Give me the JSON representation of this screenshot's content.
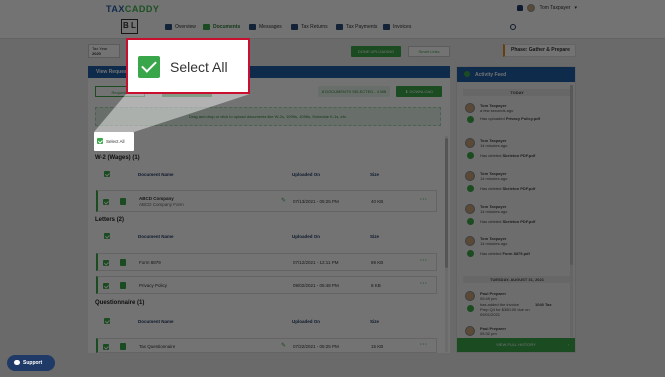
{
  "header": {
    "logo_main": "TAX",
    "logo_accent": "CADDY",
    "user_name": "Tom Taxpayer",
    "user_caret": "▾"
  },
  "nav": {
    "brand": "B L",
    "items": [
      {
        "label": "Overview",
        "icon": "home-icon"
      },
      {
        "label": "Documents",
        "icon": "documents-icon",
        "active": true
      },
      {
        "label": "Messages",
        "icon": "messages-icon"
      },
      {
        "label": "Tax Returns",
        "icon": "tax-returns-icon"
      },
      {
        "label": "Tax Payments",
        "icon": "dollar-icon"
      },
      {
        "label": "Invoices",
        "icon": "invoice-icon"
      }
    ]
  },
  "subbar": {
    "tax_year_label": "Tax Year",
    "tax_year_value": "2020",
    "done_uploading": "DONE UPLOADING",
    "smart_links": "Smart Links",
    "phase": "Phase: Gather & Prepare"
  },
  "main": {
    "title": "View Requests",
    "tab_requests": "Requests",
    "selected_info": "8 DOCUMENTS SELECTED - 4 MB",
    "download": "DOWNLOAD",
    "upload_hint": "Drag and drop or click to upload documents like W-2s, 1099s, 1098s, Schedule K-1s, etc.",
    "select_all": "Select All",
    "columns": {
      "name": "Document Name",
      "uploaded": "Uploaded On",
      "size": "Size"
    },
    "sections": [
      {
        "title": "W-2 (Wages)",
        "count": "(1)",
        "rows": [
          {
            "name": "ABCD Company",
            "sub": "ABCD Company Form",
            "date": "07/13/2021 - 05:25 PM",
            "size": "40 KB",
            "edit": true
          }
        ]
      },
      {
        "title": "Letters",
        "count": "(2)",
        "rows": [
          {
            "name": "Form 8879",
            "sub": "",
            "date": "07/12/2021 - 12:11 PM",
            "size": "89 KB",
            "edit": false
          },
          {
            "name": "Privacy Policy",
            "sub": "",
            "date": "09/02/2021 - 05:48 PM",
            "size": "8 KB",
            "edit": false
          }
        ]
      },
      {
        "title": "Questionnaire",
        "count": "(1)",
        "rows": [
          {
            "name": "Tax Questionnaire",
            "sub": "",
            "date": "07/22/2021 - 05:25 PM",
            "size": "15 KB",
            "edit": true
          }
        ]
      }
    ]
  },
  "callout": {
    "label": "Select All"
  },
  "feed": {
    "title": "Activity Feed",
    "today": "TODAY",
    "items": [
      {
        "who": "Tom Taxpayer",
        "when": "a few seconds ago",
        "what": "Has uploaded",
        "obj": "Privacy Policy.pdf"
      },
      {
        "who": "Tom Taxpayer",
        "when": "14 minutes ago",
        "what": "Has deleted",
        "obj": "Skeleton PDF.pdf"
      },
      {
        "who": "Tom Taxpayer",
        "when": "14 minutes ago",
        "what": "Has deleted",
        "obj": "Skeleton PDF.pdf"
      },
      {
        "who": "Tom Taxpayer",
        "when": "14 minutes ago",
        "what": "Has deleted",
        "obj": "Skeleton PDF.pdf"
      },
      {
        "who": "Tom Taxpayer",
        "when": "14 minutes ago",
        "what": "Has deleted",
        "obj": "Form 8879.pdf"
      }
    ],
    "day2": "TUESDAY, AUGUST 31, 2021",
    "paul1": {
      "who": "Paul Preparer",
      "when": "05:49 pm",
      "line1": "has added the invoice",
      "line2": "1040 Tax",
      "line3": "Prep Q4 for $380.00 due on",
      "line4": "09/01/2021"
    },
    "paul2": {
      "who": "Paul Preparer",
      "when": "05:32 pm"
    },
    "view_history": "VIEW FULL HISTORY"
  },
  "support": {
    "label": "Support"
  }
}
